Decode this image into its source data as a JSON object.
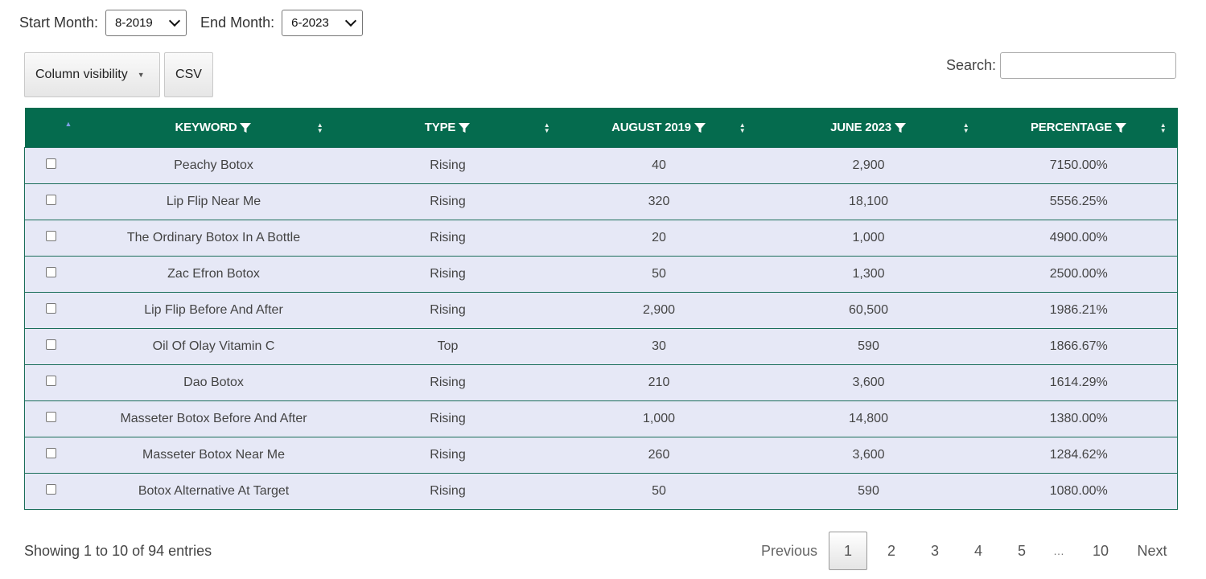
{
  "filters": {
    "start_label": "Start Month:",
    "start_value": "8-2019",
    "end_label": "End Month:",
    "end_value": "6-2023"
  },
  "toolbar": {
    "column_visibility": "Column visibility",
    "csv": "CSV",
    "search_label": "Search:",
    "search_value": ""
  },
  "table": {
    "headers": [
      "KEYWORD",
      "TYPE",
      "AUGUST 2019",
      "JUNE 2023",
      "PERCENTAGE"
    ],
    "rows": [
      {
        "keyword": "Peachy Botox",
        "type": "Rising",
        "start": "40",
        "end": "2,900",
        "pct": "7150.00%"
      },
      {
        "keyword": "Lip Flip Near Me",
        "type": "Rising",
        "start": "320",
        "end": "18,100",
        "pct": "5556.25%"
      },
      {
        "keyword": "The Ordinary Botox In A Bottle",
        "type": "Rising",
        "start": "20",
        "end": "1,000",
        "pct": "4900.00%"
      },
      {
        "keyword": "Zac Efron Botox",
        "type": "Rising",
        "start": "50",
        "end": "1,300",
        "pct": "2500.00%"
      },
      {
        "keyword": "Lip Flip Before And After",
        "type": "Rising",
        "start": "2,900",
        "end": "60,500",
        "pct": "1986.21%"
      },
      {
        "keyword": "Oil Of Olay Vitamin C",
        "type": "Top",
        "start": "30",
        "end": "590",
        "pct": "1866.67%"
      },
      {
        "keyword": "Dao Botox",
        "type": "Rising",
        "start": "210",
        "end": "3,600",
        "pct": "1614.29%"
      },
      {
        "keyword": "Masseter Botox Before And After",
        "type": "Rising",
        "start": "1,000",
        "end": "14,800",
        "pct": "1380.00%"
      },
      {
        "keyword": "Masseter Botox Near Me",
        "type": "Rising",
        "start": "260",
        "end": "3,600",
        "pct": "1284.62%"
      },
      {
        "keyword": "Botox Alternative At Target",
        "type": "Rising",
        "start": "50",
        "end": "590",
        "pct": "1080.00%"
      }
    ]
  },
  "footer": {
    "info": "Showing 1 to 10 of 94 entries",
    "previous": "Previous",
    "pages": [
      "1",
      "2",
      "3",
      "4",
      "5"
    ],
    "ellipsis": "…",
    "last_page": "10",
    "next": "Next"
  },
  "colors": {
    "header_bg": "#056b4e",
    "row_bg": "#e6e8f6",
    "row_border": "#1b6e5a"
  }
}
